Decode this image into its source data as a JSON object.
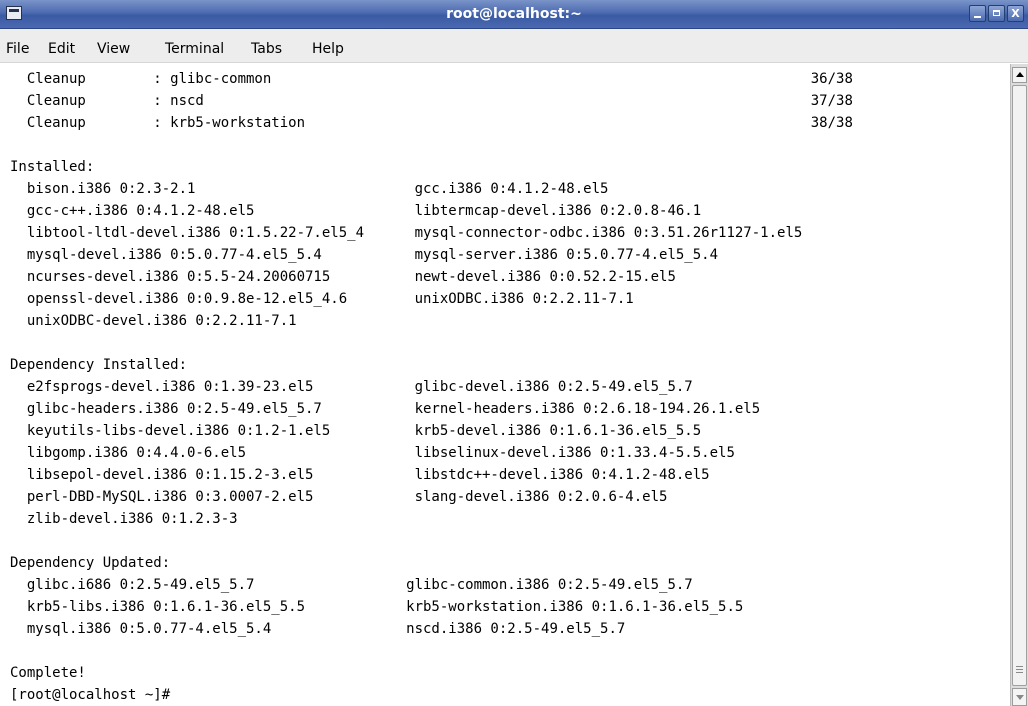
{
  "window": {
    "title": "root@localhost:~",
    "controls": {
      "minimize": "_",
      "maximize": "□",
      "close": "X"
    }
  },
  "menu": {
    "items": [
      {
        "label": "File",
        "mnemonic": "F"
      },
      {
        "label": "Edit",
        "mnemonic": "E"
      },
      {
        "label": "View",
        "mnemonic": "V"
      },
      {
        "label": "Terminal",
        "mnemonic": "T"
      },
      {
        "label": "Tabs",
        "mnemonic": "b"
      },
      {
        "label": "Help",
        "mnemonic": "H"
      }
    ]
  },
  "terminal": {
    "lines": [
      "  Cleanup        : glibc-common                                                                36/38",
      "  Cleanup        : nscd                                                                        37/38",
      "  Cleanup        : krb5-workstation                                                            38/38",
      "",
      "Installed:",
      "  bison.i386 0:2.3-2.1                          gcc.i386 0:4.1.2-48.el5",
      "  gcc-c++.i386 0:4.1.2-48.el5                   libtermcap-devel.i386 0:2.0.8-46.1",
      "  libtool-ltdl-devel.i386 0:1.5.22-7.el5_4      mysql-connector-odbc.i386 0:3.51.26r1127-1.el5",
      "  mysql-devel.i386 0:5.0.77-4.el5_5.4           mysql-server.i386 0:5.0.77-4.el5_5.4",
      "  ncurses-devel.i386 0:5.5-24.20060715          newt-devel.i386 0:0.52.2-15.el5",
      "  openssl-devel.i386 0:0.9.8e-12.el5_4.6        unixODBC.i386 0:2.2.11-7.1",
      "  unixODBC-devel.i386 0:2.2.11-7.1",
      "",
      "Dependency Installed:",
      "  e2fsprogs-devel.i386 0:1.39-23.el5            glibc-devel.i386 0:2.5-49.el5_5.7",
      "  glibc-headers.i386 0:2.5-49.el5_5.7           kernel-headers.i386 0:2.6.18-194.26.1.el5",
      "  keyutils-libs-devel.i386 0:1.2-1.el5          krb5-devel.i386 0:1.6.1-36.el5_5.5",
      "  libgomp.i386 0:4.4.0-6.el5                    libselinux-devel.i386 0:1.33.4-5.5.el5",
      "  libsepol-devel.i386 0:1.15.2-3.el5            libstdc++-devel.i386 0:4.1.2-48.el5",
      "  perl-DBD-MySQL.i386 0:3.0007-2.el5            slang-devel.i386 0:2.0.6-4.el5",
      "  zlib-devel.i386 0:1.2.3-3",
      "",
      "Dependency Updated:",
      "  glibc.i686 0:2.5-49.el5_5.7                  glibc-common.i386 0:2.5-49.el5_5.7",
      "  krb5-libs.i386 0:1.6.1-36.el5_5.5            krb5-workstation.i386 0:1.6.1-36.el5_5.5",
      "  mysql.i386 0:5.0.77-4.el5_5.4                nscd.i386 0:2.5-49.el5_5.7",
      "",
      "Complete!",
      "[root@localhost ~]#"
    ]
  },
  "scrollbar": {
    "position_fraction": 1.0
  }
}
